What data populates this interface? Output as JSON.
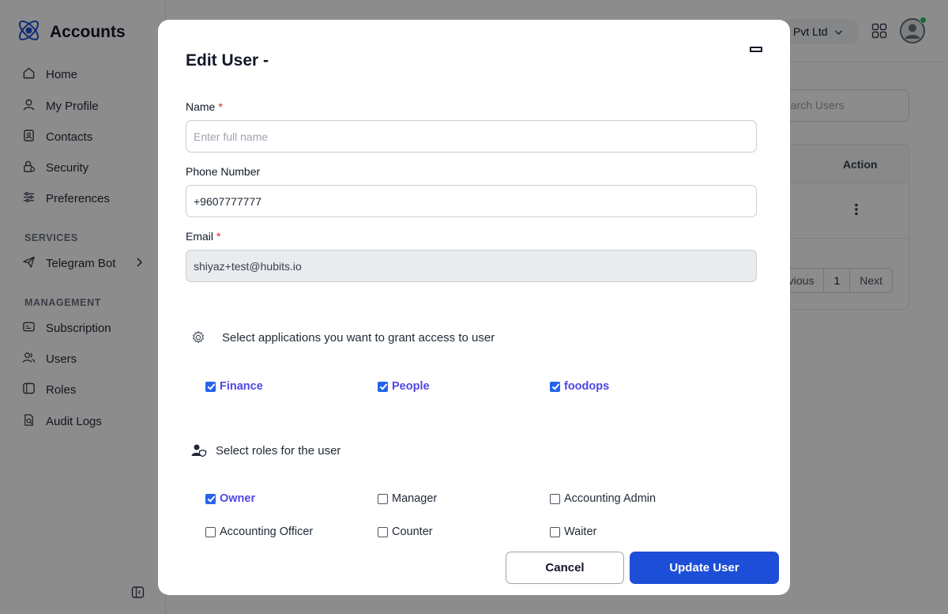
{
  "app": {
    "title": "Accounts",
    "org_name": "Pvt Ltd"
  },
  "sidebar": {
    "items": [
      {
        "label": "Home",
        "icon": "home-icon"
      },
      {
        "label": "My Profile",
        "icon": "user-icon"
      },
      {
        "label": "Contacts",
        "icon": "contacts-icon"
      },
      {
        "label": "Security",
        "icon": "security-icon"
      },
      {
        "label": "Preferences",
        "icon": "sliders-icon"
      }
    ],
    "services_heading": "SERVICES",
    "services": [
      {
        "label": "Telegram Bot",
        "icon": "send-icon"
      }
    ],
    "management_heading": "MANAGEMENT",
    "management": [
      {
        "label": "Subscription",
        "icon": "subscription-icon"
      },
      {
        "label": "Users",
        "icon": "users-icon"
      },
      {
        "label": "Roles",
        "icon": "roles-icon"
      },
      {
        "label": "Audit Logs",
        "icon": "audit-logs-icon"
      }
    ]
  },
  "main": {
    "search_placeholder": "earch Users",
    "table": {
      "action_header": "Action"
    },
    "pagination": {
      "previous": "evious",
      "current": "1",
      "next": "Next"
    }
  },
  "modal": {
    "title": "Edit User -",
    "name_label": "Name",
    "required_mark": "*",
    "name_placeholder": "Enter full name",
    "name_value": "",
    "phone_label": "Phone Number",
    "phone_value": "+9607777777",
    "email_label": "Email",
    "email_value": "shiyaz+test@hubits.io",
    "apps_heading": "Select applications you want to grant access to user",
    "applications": [
      {
        "label": "Finance",
        "checked": true
      },
      {
        "label": "People",
        "checked": true
      },
      {
        "label": "foodops",
        "checked": true
      }
    ],
    "roles_heading": "Select roles for the user",
    "roles": [
      {
        "label": "Owner",
        "checked": true
      },
      {
        "label": "Manager",
        "checked": false
      },
      {
        "label": "Accounting Admin",
        "checked": false
      },
      {
        "label": "Accounting Officer",
        "checked": false
      },
      {
        "label": "Counter",
        "checked": false
      },
      {
        "label": "Waiter",
        "checked": false
      }
    ],
    "cancel_label": "Cancel",
    "update_label": "Update User"
  },
  "colors": {
    "primary": "#1d4ed8",
    "checked_label": "#4f46e5",
    "required": "#dc2626",
    "status_online": "#22c55e"
  }
}
